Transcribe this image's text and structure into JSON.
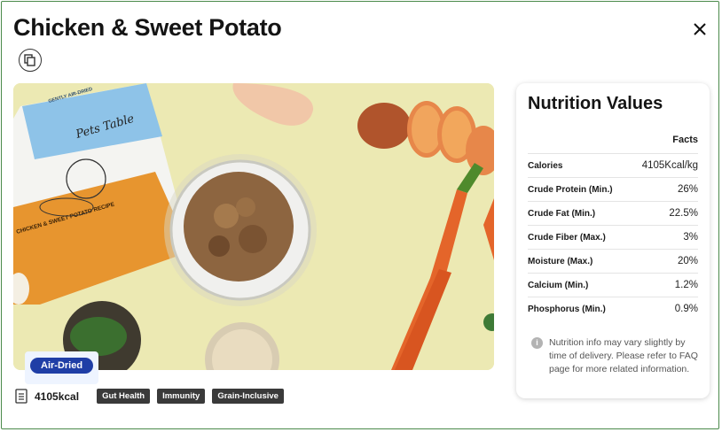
{
  "product": {
    "title": "Chicken & Sweet Potato",
    "badge": "Air-Dried",
    "calories_label": "4105kcal",
    "tags": [
      "Gut Health",
      "Immunity",
      "Grain-Inclusive"
    ]
  },
  "nutrition": {
    "heading": "Nutrition Values",
    "column_header": "Facts",
    "rows": [
      {
        "name": "Calories",
        "value": "4105Kcal/kg"
      },
      {
        "name": "Crude Protein (Min.)",
        "value": "26%"
      },
      {
        "name": "Crude Fat (Min.)",
        "value": "22.5%"
      },
      {
        "name": "Crude Fiber (Max.)",
        "value": "3%"
      },
      {
        "name": "Moisture (Max.)",
        "value": "20%"
      },
      {
        "name": "Calcium (Min.)",
        "value": "1.2%"
      },
      {
        "name": "Phosphorus (Min.)",
        "value": "0.9%"
      }
    ],
    "note": "Nutrition info may vary slightly by time of delivery. Please refer to FAQ page for more related information."
  },
  "photo": {
    "package_brand": "Pets Table",
    "package_line": "GENTLY AIR-DRIED",
    "package_title": "CHICKEN & SWEET POTATO RECIPE"
  },
  "icons": {
    "close": "close-icon",
    "copy": "copy-icon",
    "document": "document-icon",
    "info": "info-icon"
  },
  "colors": {
    "border": "#4a8a4a",
    "badge_bg": "#1f3ea6",
    "tag_bg": "#3a3a3a",
    "photo_bg": "#ece9b3"
  }
}
